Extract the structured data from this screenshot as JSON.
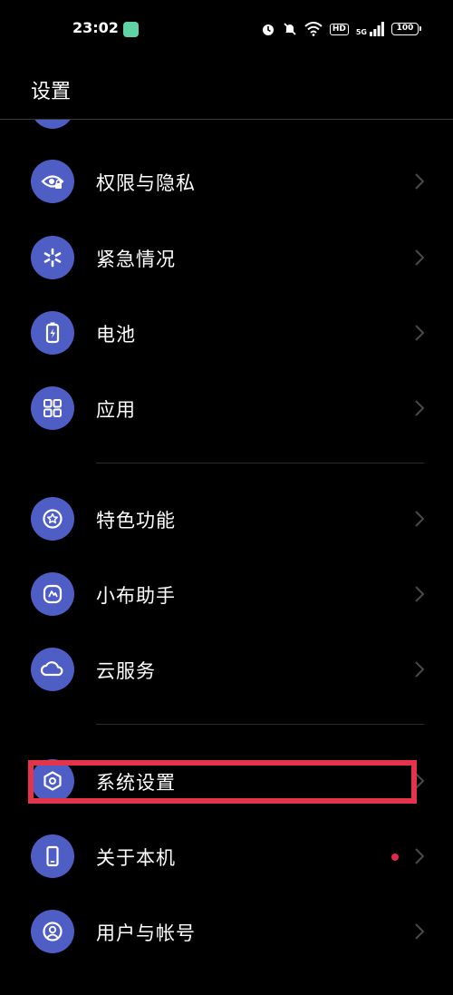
{
  "status_bar": {
    "time": "23:02",
    "network_label": "5G",
    "hd_label": "HD",
    "battery_level": "100"
  },
  "header": {
    "title": "设置"
  },
  "menu": {
    "items": [
      {
        "label": "权限与隐私",
        "icon": "eye-lock-icon"
      },
      {
        "label": "紧急情况",
        "icon": "asterisk-icon"
      },
      {
        "label": "电池",
        "icon": "battery-icon"
      },
      {
        "label": "应用",
        "icon": "app-grid-icon"
      },
      {
        "label": "特色功能",
        "icon": "star-icon"
      },
      {
        "label": "小布助手",
        "icon": "assistant-icon"
      },
      {
        "label": "云服务",
        "icon": "cloud-icon"
      },
      {
        "label": "系统设置",
        "icon": "hex-gear-icon"
      },
      {
        "label": "关于本机",
        "icon": "phone-icon"
      },
      {
        "label": "用户与帐号",
        "icon": "user-icon"
      }
    ]
  },
  "colors": {
    "background": "#000000",
    "icon_circle": "#4f5ec4",
    "chevron": "#4a4a4a",
    "highlight": "#e3344b",
    "badge": "#e0284d"
  }
}
